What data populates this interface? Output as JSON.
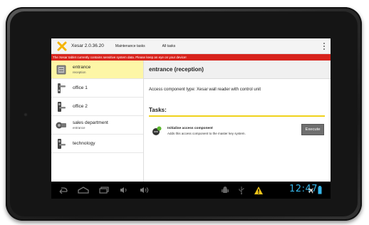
{
  "action_bar": {
    "app_title": "Xesar 2.0.36.20",
    "tabs": [
      "Maintenance tasks",
      "All tasks"
    ],
    "overflow_icon": "overflow-menu-icon"
  },
  "warning_banner": "The Xesar tablet currently contains sensitive system data. Please keep an eye on your device!",
  "sidebar": {
    "items": [
      {
        "label": "entrance",
        "sub": "reception",
        "icon": "wall-reader-icon",
        "selected": true
      },
      {
        "label": "office 1",
        "sub": "",
        "icon": "door-handle-icon",
        "selected": false
      },
      {
        "label": "office 2",
        "sub": "",
        "icon": "door-fitting-icon",
        "selected": false
      },
      {
        "label": "sales department",
        "sub": "entrance",
        "icon": "cylinder-icon",
        "selected": false
      },
      {
        "label": "technology",
        "sub": "",
        "icon": "door-fitting-icon",
        "selected": false
      }
    ]
  },
  "detail": {
    "header": "entrance (reception)",
    "type_line": "Access component type: Xesar wall reader with control unit",
    "tasks_title": "Tasks:",
    "task": {
      "title": "Initialise access component",
      "description": "Adds this access component to the master key system.",
      "button_label": "Execute"
    }
  },
  "system_bar": {
    "clock": "12:47"
  },
  "colors": {
    "accent_yellow": "#f0d21c",
    "warning_red": "#d8231c",
    "selected_bg": "#fdf6a6",
    "clock_blue": "#35b5e8"
  }
}
